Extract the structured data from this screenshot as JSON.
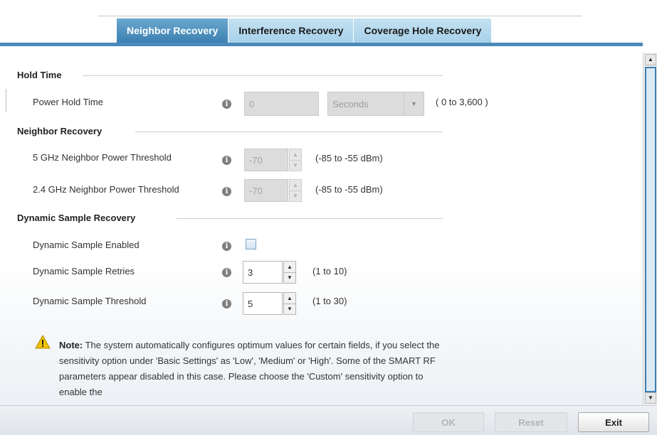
{
  "tabs": [
    {
      "label": "Neighbor Recovery",
      "active": true
    },
    {
      "label": "Interference Recovery",
      "active": false
    },
    {
      "label": "Coverage Hole Recovery",
      "active": false
    }
  ],
  "hold_time": {
    "title": "Hold Time",
    "power_hold_time": {
      "label": "Power Hold Time",
      "value": "0",
      "unit": "Seconds",
      "range": "( 0 to 3,600 )",
      "disabled": true
    }
  },
  "neighbor_recovery": {
    "title": "Neighbor Recovery",
    "ghz5": {
      "label": "5 GHz Neighbor Power Threshold",
      "value": "-70",
      "range": "(-85 to -55 dBm)",
      "disabled": true
    },
    "ghz24": {
      "label": "2.4 GHz Neighbor Power Threshold",
      "value": "-70",
      "range": "(-85 to -55 dBm)",
      "disabled": true
    }
  },
  "dynamic_sample": {
    "title": "Dynamic Sample Recovery",
    "enabled": {
      "label": "Dynamic Sample Enabled",
      "checked": false
    },
    "retries": {
      "label": "Dynamic Sample Retries",
      "value": "3",
      "range": "(1 to 10)"
    },
    "threshold": {
      "label": "Dynamic Sample Threshold",
      "value": "5",
      "range": "(1 to 30)"
    }
  },
  "note": {
    "prefix": "Note:",
    "text": " The system automatically configures optimum values for certain fields, if you select the sensitivity option under 'Basic Settings' as 'Low', 'Medium' or 'High'. Some of the SMART RF parameters appear disabled in this case. Please choose the 'Custom' sensitivity option to enable the"
  },
  "info_icon": "i",
  "icons": {
    "info": "info-icon",
    "warning": "warning-icon",
    "dropdown": "chevron-down-icon",
    "spin_up": "arrow-up-icon",
    "spin_down": "arrow-down-icon"
  },
  "footer": {
    "ok_label": "OK",
    "reset_label": "Reset",
    "exit_label": "Exit"
  },
  "colors": {
    "active_tab": "#3c80b1",
    "inactive_tab": "#a7d1ea",
    "tab_underline": "#4a8ab9",
    "scroll_thumb_border": "#3c7fb1"
  }
}
